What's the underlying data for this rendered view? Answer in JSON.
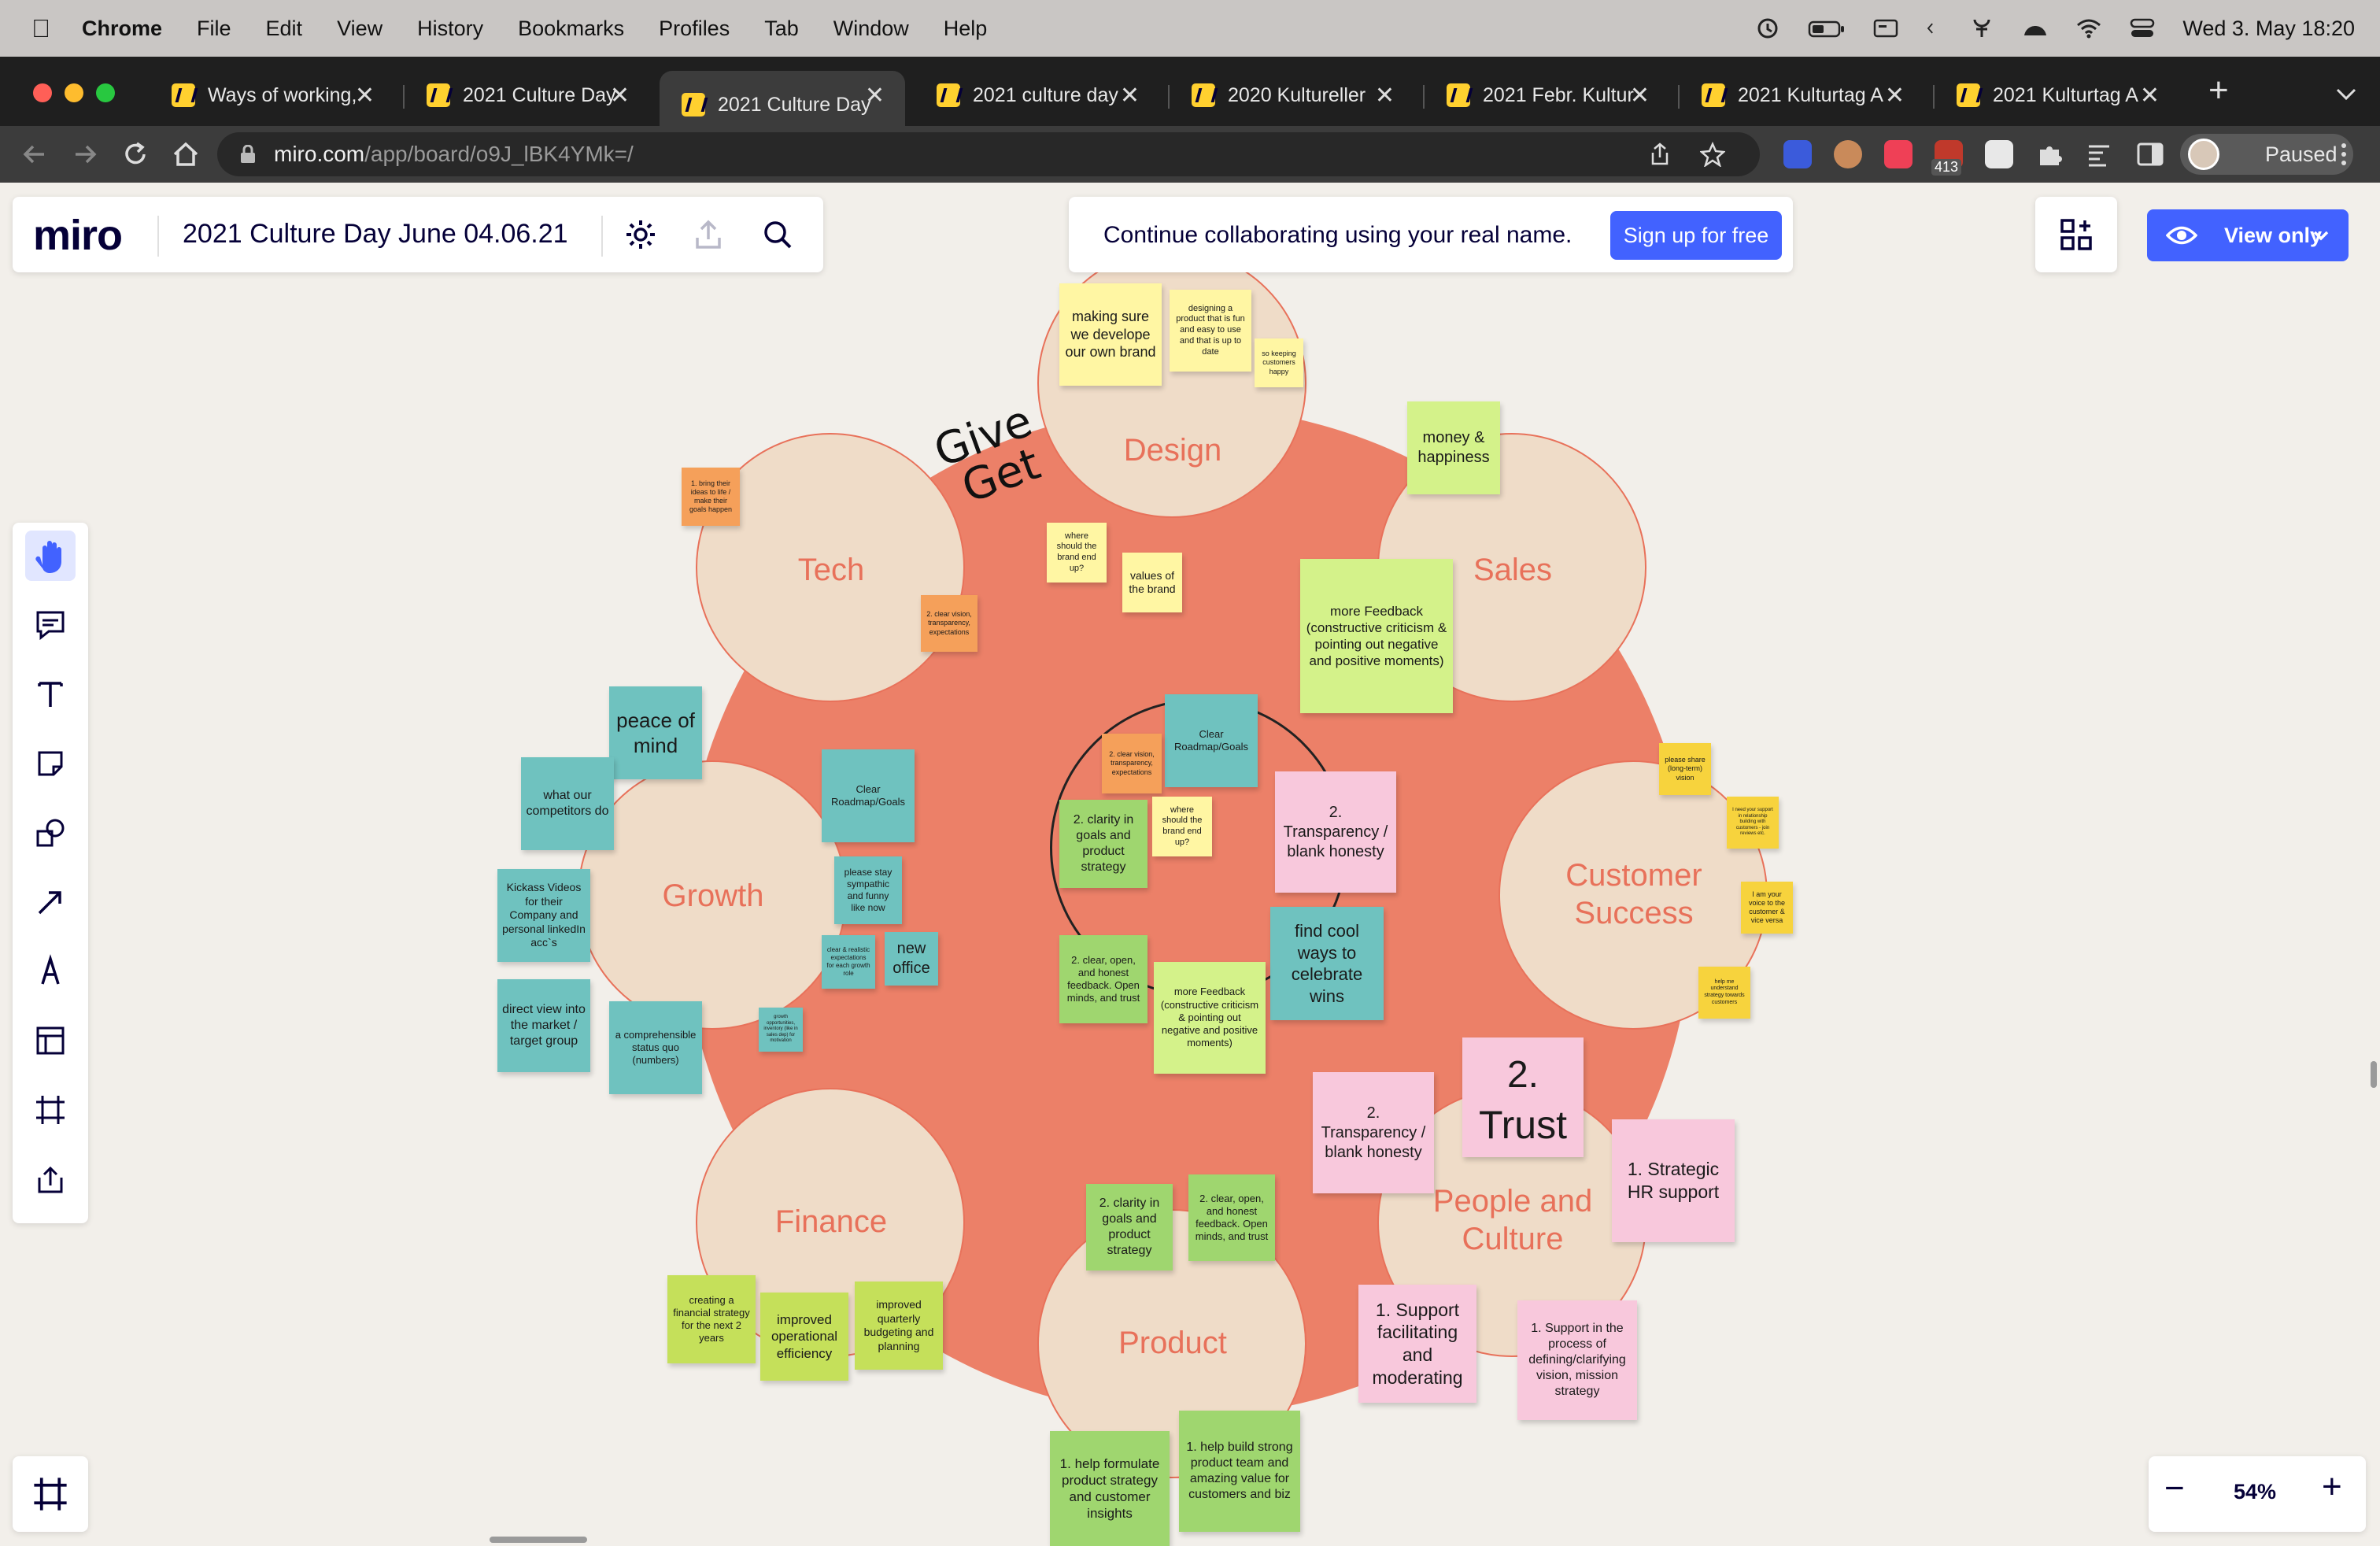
{
  "menubar": {
    "app": "Chrome",
    "items": [
      "File",
      "Edit",
      "View",
      "History",
      "Bookmarks",
      "Profiles",
      "Tab",
      "Window",
      "Help"
    ],
    "datetime": "Wed 3. May  18:20"
  },
  "tabs": [
    {
      "label": "Ways of working,"
    },
    {
      "label": "2021 Culture Day"
    },
    {
      "label": "2021 Culture Day"
    },
    {
      "label": "2021 culture day"
    },
    {
      "label": "2020 Kultureller"
    },
    {
      "label": "2021 Febr. Kultur"
    },
    {
      "label": "2021 Kulturtag A"
    },
    {
      "label": "2021 Kulturtag A"
    }
  ],
  "address": {
    "host": "miro.com",
    "path": "/app/board/o9J_lBK4YMk=/"
  },
  "extensions": {
    "badge": "413",
    "profile_label": "Paused"
  },
  "miro": {
    "logo": "miro",
    "board_title": "2021 Culture Day June 04.06.21",
    "collab_text": "Continue collaborating using your real name.",
    "signup_label": "Sign up for free",
    "view_only_label": "View only",
    "zoom": "54%",
    "zoom_minus": "−",
    "zoom_plus": "+"
  },
  "board": {
    "give": "Give",
    "get": "Get",
    "circles": {
      "design": "Design",
      "sales": "Sales",
      "tech": "Tech",
      "growth": "Growth",
      "customer_success_1": "Customer",
      "customer_success_2": "Success",
      "finance": "Finance",
      "product": "Product",
      "people_1": "People and",
      "people_2": "Culture"
    },
    "stickies": {
      "s1": "making sure we develope our own brand",
      "s2": "designing a product that is fun and easy to use and that is up to date",
      "s3": "so keeping customers happy",
      "s4": "money & happiness",
      "s5": "1. bring their ideas to life / make their goals happen",
      "s6": "where should the brand end up?",
      "s7": "values of the brand",
      "s8": "2. clear vision, transparency, expectations",
      "s9": "more Feedback (constructive criticism & pointing out negative and positive moments)",
      "s10": "peace of mind",
      "s11": "what our competitors do",
      "s12": "Clear Roadmap/Goals",
      "s13": "Kickass Videos for their Company and personal linkedIn acc`s",
      "s14": "please stay sympathic and funny like now",
      "s15": "clear & realistic expectations for each growth role",
      "s16": "new office",
      "s17": "direct view into the market / target group",
      "s18": "a comprehensible status quo (numbers)",
      "s19": "growth opportunities, inventory (like in sales dep) for motivation",
      "s20": "Clear Roadmap/Goals",
      "s21": "2. clear vision, transparency, expectations",
      "s22": "2. clarity in goals and product strategy",
      "s23": "where should the brand end up?",
      "s24": "2. Transparency / blank honesty",
      "s25": "find cool ways to celebrate wins",
      "s26": "2. clear, open, and honest feedback. Open minds, and trust",
      "s27": "more Feedback (constructive criticism & pointing out negative and positive moments)",
      "s28": "please share (long-term) vision",
      "s29": "I need your support in relationship building with customers - join reviews etc.",
      "s30": "I am your voice to the customer & vice versa",
      "s31": "help me understand strategy towards customers",
      "s32": "2.",
      "s33": "Trust",
      "s34": "2. Transparency / blank honesty",
      "s35": "1. Strategic HR support",
      "s36": "2. clarity in goals and product strategy",
      "s37": "2. clear, open, and honest feedback. Open minds, and trust",
      "s38": "creating a financial strategy for the next 2 years",
      "s39": "improved operational efficiency",
      "s40": "improved quarterly budgeting and planning",
      "s41": "1. Support facilitating and moderating",
      "s42": "1. Support in the process of defining/clarifying vision, mission strategy",
      "s43": "1. help formulate product strategy and customer insights",
      "s44": "1. help build strong product team and amazing value for customers and biz"
    }
  },
  "colors": {
    "canvas": "#f2efea",
    "big_circle": "#ec8068",
    "small_circle": "#efdcc8",
    "label": "#e8715a",
    "yellow": "#fff6a3",
    "light_green": "#d4f28a",
    "green": "#9fd66f",
    "teal": "#6fc2bf",
    "orange": "#f5a05a",
    "pink": "#f8c8dc",
    "gold": "#f7d33d",
    "miro_blue": "#4262ff"
  }
}
